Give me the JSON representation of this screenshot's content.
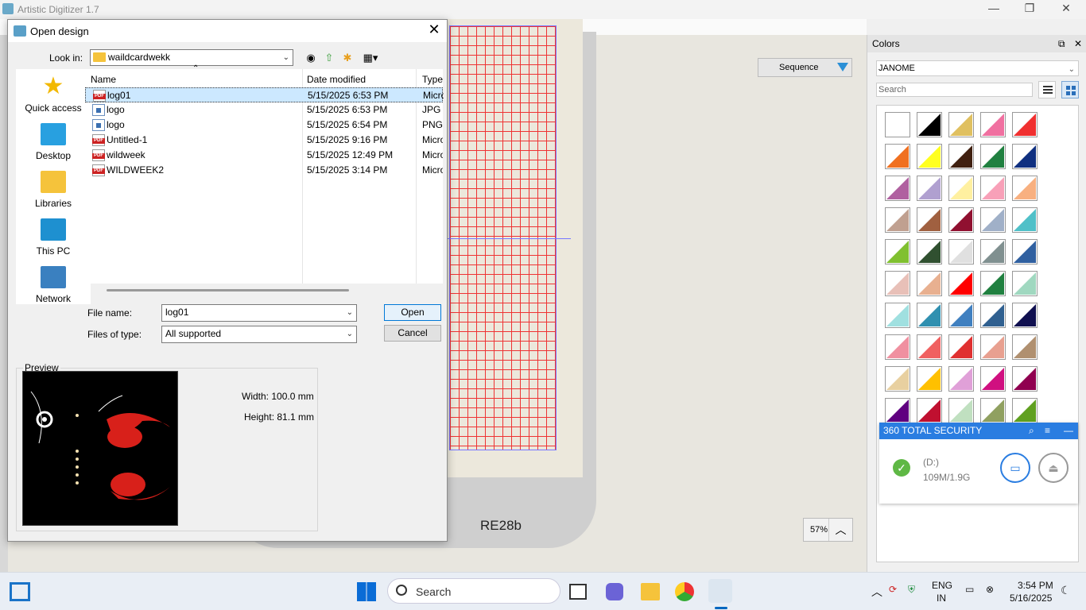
{
  "app": {
    "title": "Artistic Digitizer 1.7",
    "window_buttons": [
      "—",
      "❐",
      "✕"
    ]
  },
  "workspace": {
    "sequence_label": "Sequence",
    "design_label": "RE28b",
    "zoom_label": "57%"
  },
  "colors_panel": {
    "title": "Colors",
    "palette": "JANOME",
    "search_placeholder": "Search",
    "swatches": [
      "#ffffff",
      "#000000",
      "#e0c060",
      "#f070a0",
      "#f03030",
      "#f07020",
      "#ffff20",
      "#402010",
      "#208040",
      "#103080",
      "#b060a0",
      "#b0a0d0",
      "#fff0a0",
      "#f8a0b8",
      "#f8b080",
      "#c0a090",
      "#a06040",
      "#901030",
      "#a0b0c8",
      "#50c0c8",
      "#80c030",
      "#305030",
      "#e0e0e0",
      "#809090",
      "#3060a0",
      "#e8c0b8",
      "#e8b090",
      "#ff0000",
      "#208040",
      "#a0d8c0",
      "#a0e0e0",
      "#3090b0",
      "#4080c0",
      "#306090",
      "#101050",
      "#f090a0",
      "#f06060",
      "#e03030",
      "#e8a090",
      "#b09070",
      "#e8d0a0",
      "#ffc000",
      "#e0a0d8",
      "#d01080",
      "#900050",
      "#600080",
      "#c01030",
      "#c0e0c0",
      "#90a060",
      "#60a020",
      "#603010",
      "#503010",
      "#402010",
      "#503090",
      "#102080",
      "#2070b0",
      "#a0d060",
      "#f03080",
      "#e080a0",
      "#a04060"
    ]
  },
  "security_popup": {
    "title": "360 TOTAL SECURITY",
    "drive": "(D:)",
    "capacity": "109M/1.9G"
  },
  "dialog": {
    "title": "Open design",
    "look_in_label": "Look in:",
    "look_in_value": "waildcardwekk",
    "places": [
      "Quick access",
      "Desktop",
      "Libraries",
      "This PC",
      "Network"
    ],
    "columns": {
      "name": "Name",
      "date": "Date modified",
      "type": "Type"
    },
    "files": [
      {
        "name": "log01",
        "date": "5/15/2025 6:53 PM",
        "type": "Micro",
        "icon": "pdf"
      },
      {
        "name": "logo",
        "date": "5/15/2025 6:53 PM",
        "type": "JPG F",
        "icon": "img"
      },
      {
        "name": "logo",
        "date": "5/15/2025 6:54 PM",
        "type": "PNG",
        "icon": "img"
      },
      {
        "name": "Untitled-1",
        "date": "5/15/2025 9:16 PM",
        "type": "Micro",
        "icon": "pdf"
      },
      {
        "name": "wildweek",
        "date": "5/15/2025 12:49 PM",
        "type": "Micro",
        "icon": "pdf"
      },
      {
        "name": "WILDWEEK2",
        "date": "5/15/2025 3:14 PM",
        "type": "Micro",
        "icon": "pdf"
      }
    ],
    "file_name_label": "File name:",
    "file_name_value": "log01",
    "files_of_type_label": "Files of type:",
    "files_of_type_value": "All supported",
    "open_label": "Open",
    "cancel_label": "Cancel",
    "preview_label": "Preview",
    "width_text": "Width: 100.0 mm",
    "height_text": "Height: 81.1 mm"
  },
  "taskbar": {
    "search_placeholder": "Search",
    "lang_top": "ENG",
    "lang_bottom": "IN",
    "time": "3:54 PM",
    "date": "5/16/2025"
  }
}
